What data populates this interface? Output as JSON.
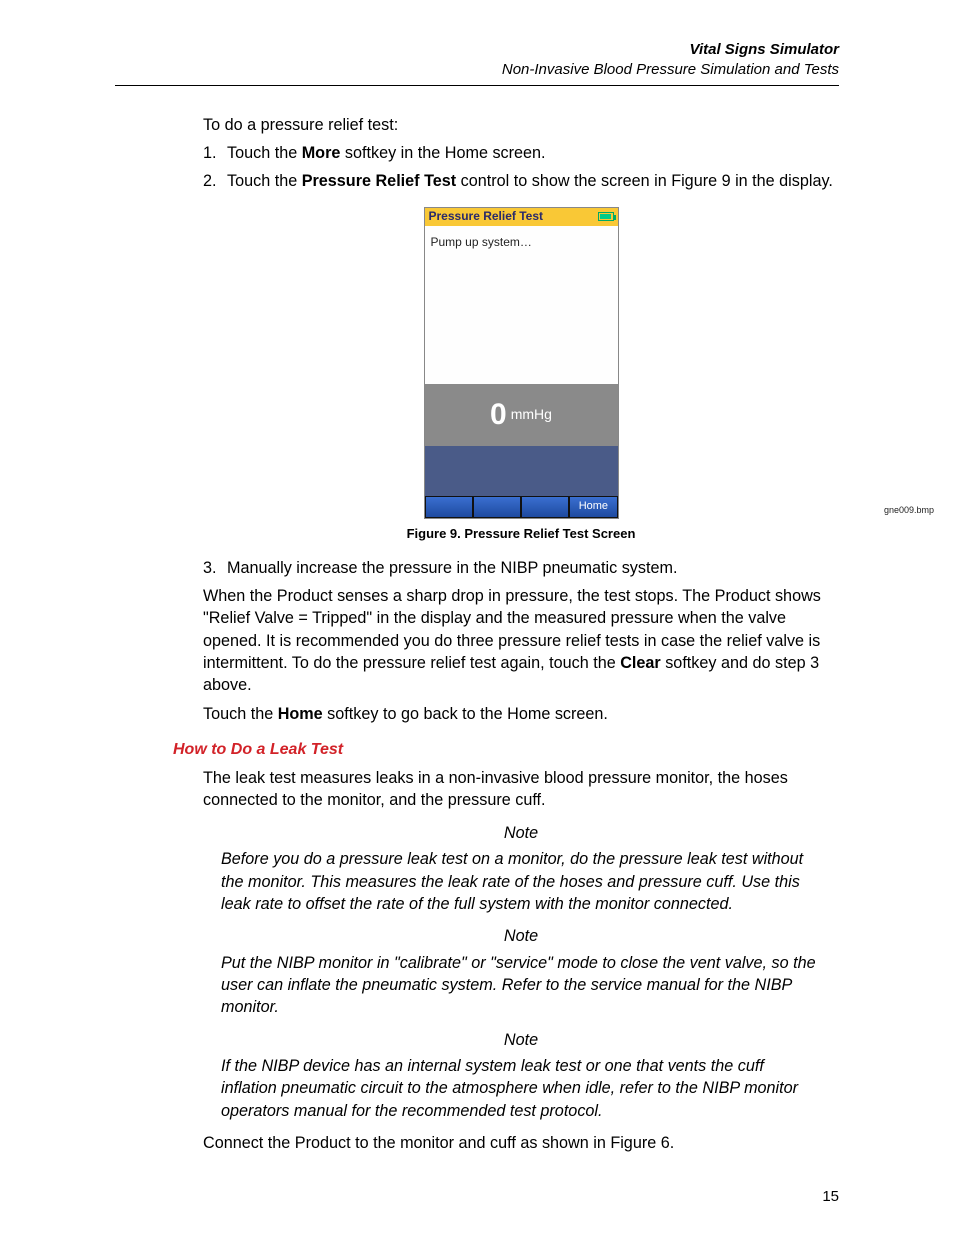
{
  "header": {
    "title": "Vital Signs Simulator",
    "subtitle": "Non-Invasive Blood Pressure Simulation and Tests"
  },
  "intro": "To do a pressure relief test:",
  "steps": {
    "s1_pre": "Touch the ",
    "s1_bold": "More",
    "s1_post": " softkey in the Home screen.",
    "s2_pre": "Touch the ",
    "s2_bold": "Pressure Relief Test",
    "s2_post": " control to show the screen in Figure 9 in the display.",
    "s3": "Manually increase the pressure in the NIBP pneumatic system."
  },
  "device": {
    "title": "Pressure Relief Test",
    "body": "Pump up system…",
    "reading_value": "0",
    "reading_unit": "mmHg",
    "softkey_home": "Home"
  },
  "fig_ref": "gne009.bmp",
  "fig_caption": "Figure 9. Pressure Relief Test Screen",
  "para_sense_pre": "When the Product senses a sharp drop in pressure, the test stops. The Product shows \"Relief Valve = Tripped\" in the display and the measured pressure when the valve opened. It is recommended you do three pressure relief tests in case the relief valve is intermittent. To do the pressure relief test again, touch the ",
  "para_sense_bold": "Clear",
  "para_sense_post": " softkey and do step 3 above.",
  "touch_home_pre": "Touch the ",
  "touch_home_bold": "Home",
  "touch_home_post": " softkey to go back to the Home screen.",
  "section_title": "How to Do a Leak Test",
  "leak_intro": "The leak test measures leaks in a non-invasive blood pressure monitor, the hoses connected to the monitor, and the pressure cuff.",
  "note_label": "Note",
  "note1": "Before you do a pressure leak test on a monitor, do the pressure leak test without the monitor. This measures the leak rate of the hoses and pressure cuff. Use this leak rate to offset the rate of the full system with the monitor connected.",
  "note2": "Put the NIBP monitor in \"calibrate\" or \"service\" mode to close the vent valve, so the user can inflate the pneumatic system. Refer to the service manual for the NIBP monitor.",
  "note3": "If the NIBP device has an internal system leak test or one that vents the cuff inflation pneumatic circuit to the atmosphere when idle, refer to the NIBP monitor operators manual for the recommended test protocol.",
  "connect": "Connect the Product to the monitor and cuff as shown in Figure 6.",
  "page_num": "15"
}
